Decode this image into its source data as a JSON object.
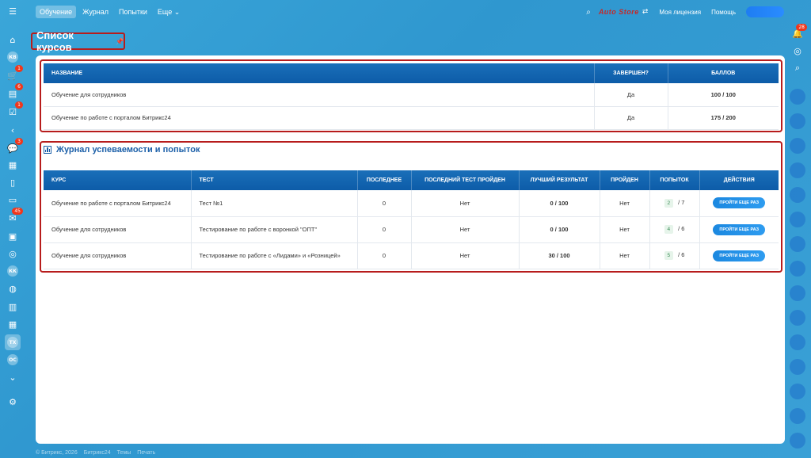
{
  "left_rail": {
    "avatars": [
      "КВ",
      "КК",
      "ТХ",
      "ОС"
    ],
    "badges": [
      "1",
      "6",
      "1",
      "3",
      "45"
    ]
  },
  "topbar": {
    "tabs": [
      "Обучение",
      "Журнал",
      "Попытки",
      "Еще"
    ],
    "more_chevron": "⌄",
    "logo": "Auto Store",
    "license": "Моя лицензия",
    "help": "Помощь"
  },
  "right_rail": {
    "badge": "28"
  },
  "page_title": "Список курсов",
  "courses": {
    "headers": [
      "Название",
      "Завершен?",
      "Баллов"
    ],
    "rows": [
      {
        "name": "Обучение для сотрудников",
        "done": "Да",
        "score": "100 / 100"
      },
      {
        "name": "Обучение по работе с порталом Битрикс24",
        "done": "Да",
        "score": "175 / 200"
      }
    ]
  },
  "journal": {
    "title": "Журнал успеваемости и попыток",
    "headers": [
      "Курс",
      "Тест",
      "Последнее",
      "Последний тест пройден",
      "Лучший результат",
      "Пройден",
      "Попыток",
      "Действия"
    ],
    "rows": [
      {
        "course": "Обучение по работе с порталом Битрикс24",
        "test": "Тест №1",
        "last": "0",
        "last_passed": "Нет",
        "best": "0 / 100",
        "passed": "Нет",
        "attempts": "2",
        "attempts_max": "/ 7",
        "action": "Пройти еще раз"
      },
      {
        "course": "Обучение для сотрудников",
        "test": "Тестирование по работе с воронкой \"ОПТ\"",
        "last": "0",
        "last_passed": "Нет",
        "best": "0 / 100",
        "passed": "Нет",
        "attempts": "4",
        "attempts_max": "/ 6",
        "action": "Пройти еще раз"
      },
      {
        "course": "Обучение для сотрудников",
        "test": "Тестирование по работе с «Лидами» и «Розницей»",
        "last": "0",
        "last_passed": "Нет",
        "best": "30 / 100",
        "passed": "Нет",
        "attempts": "5",
        "attempts_max": "/ 6",
        "action": "Пройти еще раз"
      }
    ]
  },
  "footer": [
    "© Битрикс, 2026",
    "Битрикс24",
    "Темы",
    "Печать"
  ]
}
